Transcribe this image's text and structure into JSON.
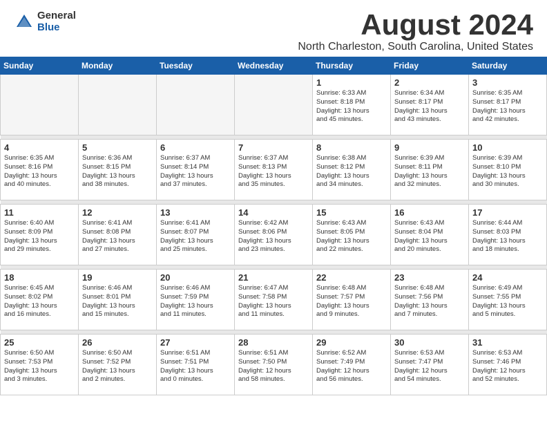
{
  "header": {
    "logo_general": "General",
    "logo_blue": "Blue",
    "month_title": "August 2024",
    "location": "North Charleston, South Carolina, United States"
  },
  "weekdays": [
    "Sunday",
    "Monday",
    "Tuesday",
    "Wednesday",
    "Thursday",
    "Friday",
    "Saturday"
  ],
  "weeks": [
    [
      {
        "day": "",
        "info": ""
      },
      {
        "day": "",
        "info": ""
      },
      {
        "day": "",
        "info": ""
      },
      {
        "day": "",
        "info": ""
      },
      {
        "day": "1",
        "info": "Sunrise: 6:33 AM\nSunset: 8:18 PM\nDaylight: 13 hours\nand 45 minutes."
      },
      {
        "day": "2",
        "info": "Sunrise: 6:34 AM\nSunset: 8:17 PM\nDaylight: 13 hours\nand 43 minutes."
      },
      {
        "day": "3",
        "info": "Sunrise: 6:35 AM\nSunset: 8:17 PM\nDaylight: 13 hours\nand 42 minutes."
      }
    ],
    [
      {
        "day": "4",
        "info": "Sunrise: 6:35 AM\nSunset: 8:16 PM\nDaylight: 13 hours\nand 40 minutes."
      },
      {
        "day": "5",
        "info": "Sunrise: 6:36 AM\nSunset: 8:15 PM\nDaylight: 13 hours\nand 38 minutes."
      },
      {
        "day": "6",
        "info": "Sunrise: 6:37 AM\nSunset: 8:14 PM\nDaylight: 13 hours\nand 37 minutes."
      },
      {
        "day": "7",
        "info": "Sunrise: 6:37 AM\nSunset: 8:13 PM\nDaylight: 13 hours\nand 35 minutes."
      },
      {
        "day": "8",
        "info": "Sunrise: 6:38 AM\nSunset: 8:12 PM\nDaylight: 13 hours\nand 34 minutes."
      },
      {
        "day": "9",
        "info": "Sunrise: 6:39 AM\nSunset: 8:11 PM\nDaylight: 13 hours\nand 32 minutes."
      },
      {
        "day": "10",
        "info": "Sunrise: 6:39 AM\nSunset: 8:10 PM\nDaylight: 13 hours\nand 30 minutes."
      }
    ],
    [
      {
        "day": "11",
        "info": "Sunrise: 6:40 AM\nSunset: 8:09 PM\nDaylight: 13 hours\nand 29 minutes."
      },
      {
        "day": "12",
        "info": "Sunrise: 6:41 AM\nSunset: 8:08 PM\nDaylight: 13 hours\nand 27 minutes."
      },
      {
        "day": "13",
        "info": "Sunrise: 6:41 AM\nSunset: 8:07 PM\nDaylight: 13 hours\nand 25 minutes."
      },
      {
        "day": "14",
        "info": "Sunrise: 6:42 AM\nSunset: 8:06 PM\nDaylight: 13 hours\nand 23 minutes."
      },
      {
        "day": "15",
        "info": "Sunrise: 6:43 AM\nSunset: 8:05 PM\nDaylight: 13 hours\nand 22 minutes."
      },
      {
        "day": "16",
        "info": "Sunrise: 6:43 AM\nSunset: 8:04 PM\nDaylight: 13 hours\nand 20 minutes."
      },
      {
        "day": "17",
        "info": "Sunrise: 6:44 AM\nSunset: 8:03 PM\nDaylight: 13 hours\nand 18 minutes."
      }
    ],
    [
      {
        "day": "18",
        "info": "Sunrise: 6:45 AM\nSunset: 8:02 PM\nDaylight: 13 hours\nand 16 minutes."
      },
      {
        "day": "19",
        "info": "Sunrise: 6:46 AM\nSunset: 8:01 PM\nDaylight: 13 hours\nand 15 minutes."
      },
      {
        "day": "20",
        "info": "Sunrise: 6:46 AM\nSunset: 7:59 PM\nDaylight: 13 hours\nand 11 minutes."
      },
      {
        "day": "21",
        "info": "Sunrise: 6:47 AM\nSunset: 7:58 PM\nDaylight: 13 hours\nand 11 minutes."
      },
      {
        "day": "22",
        "info": "Sunrise: 6:48 AM\nSunset: 7:57 PM\nDaylight: 13 hours\nand 9 minutes."
      },
      {
        "day": "23",
        "info": "Sunrise: 6:48 AM\nSunset: 7:56 PM\nDaylight: 13 hours\nand 7 minutes."
      },
      {
        "day": "24",
        "info": "Sunrise: 6:49 AM\nSunset: 7:55 PM\nDaylight: 13 hours\nand 5 minutes."
      }
    ],
    [
      {
        "day": "25",
        "info": "Sunrise: 6:50 AM\nSunset: 7:53 PM\nDaylight: 13 hours\nand 3 minutes."
      },
      {
        "day": "26",
        "info": "Sunrise: 6:50 AM\nSunset: 7:52 PM\nDaylight: 13 hours\nand 2 minutes."
      },
      {
        "day": "27",
        "info": "Sunrise: 6:51 AM\nSunset: 7:51 PM\nDaylight: 13 hours\nand 0 minutes."
      },
      {
        "day": "28",
        "info": "Sunrise: 6:51 AM\nSunset: 7:50 PM\nDaylight: 12 hours\nand 58 minutes."
      },
      {
        "day": "29",
        "info": "Sunrise: 6:52 AM\nSunset: 7:49 PM\nDaylight: 12 hours\nand 56 minutes."
      },
      {
        "day": "30",
        "info": "Sunrise: 6:53 AM\nSunset: 7:47 PM\nDaylight: 12 hours\nand 54 minutes."
      },
      {
        "day": "31",
        "info": "Sunrise: 6:53 AM\nSunset: 7:46 PM\nDaylight: 12 hours\nand 52 minutes."
      }
    ]
  ]
}
